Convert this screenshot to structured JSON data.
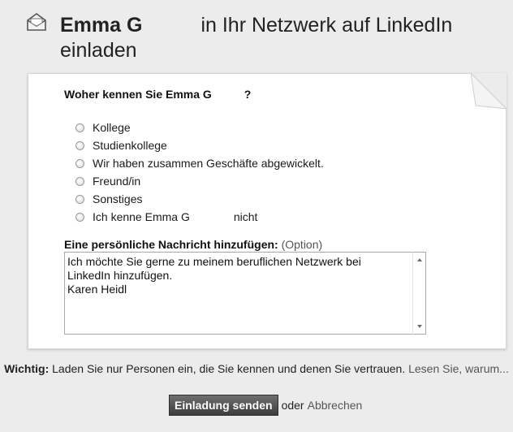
{
  "header": {
    "icon": "envelope-icon",
    "name": "Emma G",
    "title_rest": "in Ihr Netzwerk auf LinkedIn",
    "title_line2": "einladen"
  },
  "question": {
    "prefix": "Woher kennen Sie Emma G",
    "suffix": "?"
  },
  "options": [
    {
      "label": "Kollege"
    },
    {
      "label": "Studienkollege"
    },
    {
      "label": "Wir haben zusammen Geschäfte abgewickelt."
    },
    {
      "label": "Freund/in"
    },
    {
      "label": "Sonstiges"
    },
    {
      "label": "Ich kenne Emma G",
      "suffix": "nicht"
    }
  ],
  "message": {
    "label": "Eine persönliche Nachricht hinzufügen:",
    "optional": "(Option)",
    "value": "Ich möchte Sie gerne zu meinem beruflichen Netzwerk bei LinkedIn hinzufügen.\nKaren Heidl"
  },
  "warning": {
    "strong": "Wichtig:",
    "text": "Laden Sie nur Personen ein, die Sie kennen und denen Sie vertrauen.",
    "link": "Lesen Sie, warum..."
  },
  "actions": {
    "send_label": "Einladung senden",
    "or": "oder",
    "cancel_label": "Abbrechen"
  }
}
